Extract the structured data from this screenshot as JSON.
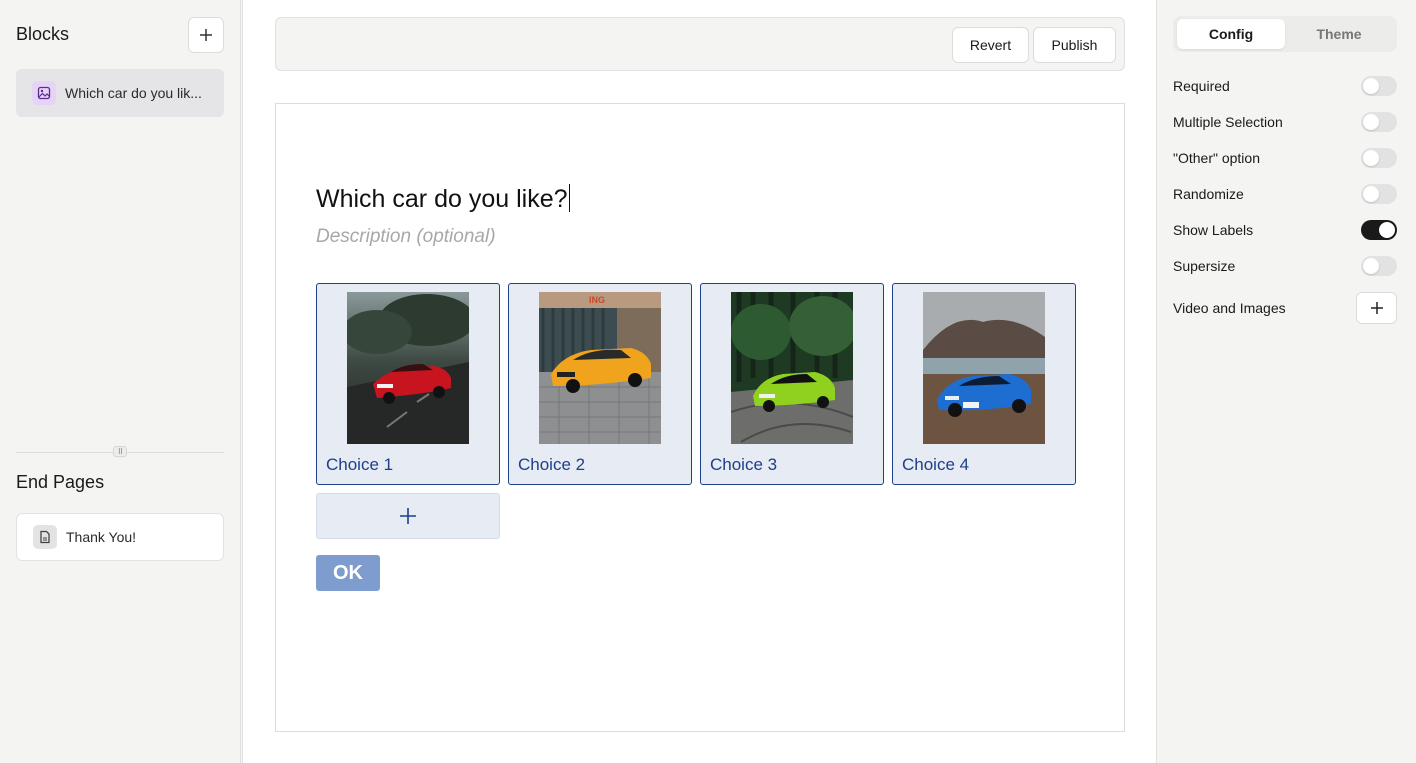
{
  "left": {
    "blocks_title": "Blocks",
    "blocks": [
      {
        "label": "Which car do you lik...",
        "icon": "image-icon"
      }
    ],
    "end_pages_title": "End Pages",
    "end_pages": [
      {
        "label": "Thank You!",
        "icon": "page-icon"
      }
    ]
  },
  "toolbar": {
    "revert_label": "Revert",
    "publish_label": "Publish"
  },
  "question": {
    "title": "Which car do you like?",
    "description_placeholder": "Description (optional)",
    "choices": [
      {
        "label": "Choice 1",
        "image": "red-sports-car"
      },
      {
        "label": "Choice 2",
        "image": "orange-supercar"
      },
      {
        "label": "Choice 3",
        "image": "lime-green-hatchback"
      },
      {
        "label": "Choice 4",
        "image": "blue-coupe"
      }
    ],
    "ok_label": "OK"
  },
  "right": {
    "tabs": [
      "Config",
      "Theme"
    ],
    "active_tab": "Config",
    "options": [
      {
        "label": "Required",
        "on": false
      },
      {
        "label": "Multiple Selection",
        "on": false
      },
      {
        "label": "\"Other\" option",
        "on": false
      },
      {
        "label": "Randomize",
        "on": false
      },
      {
        "label": "Show Labels",
        "on": true
      },
      {
        "label": "Supersize",
        "on": false
      }
    ],
    "media_label": "Video and Images"
  },
  "colors": {
    "accent": "#1e3f8a",
    "choice_bg": "#e6ebf4",
    "ok_bg": "#7f9ccf",
    "toggle_on": "#1a1a1a"
  }
}
